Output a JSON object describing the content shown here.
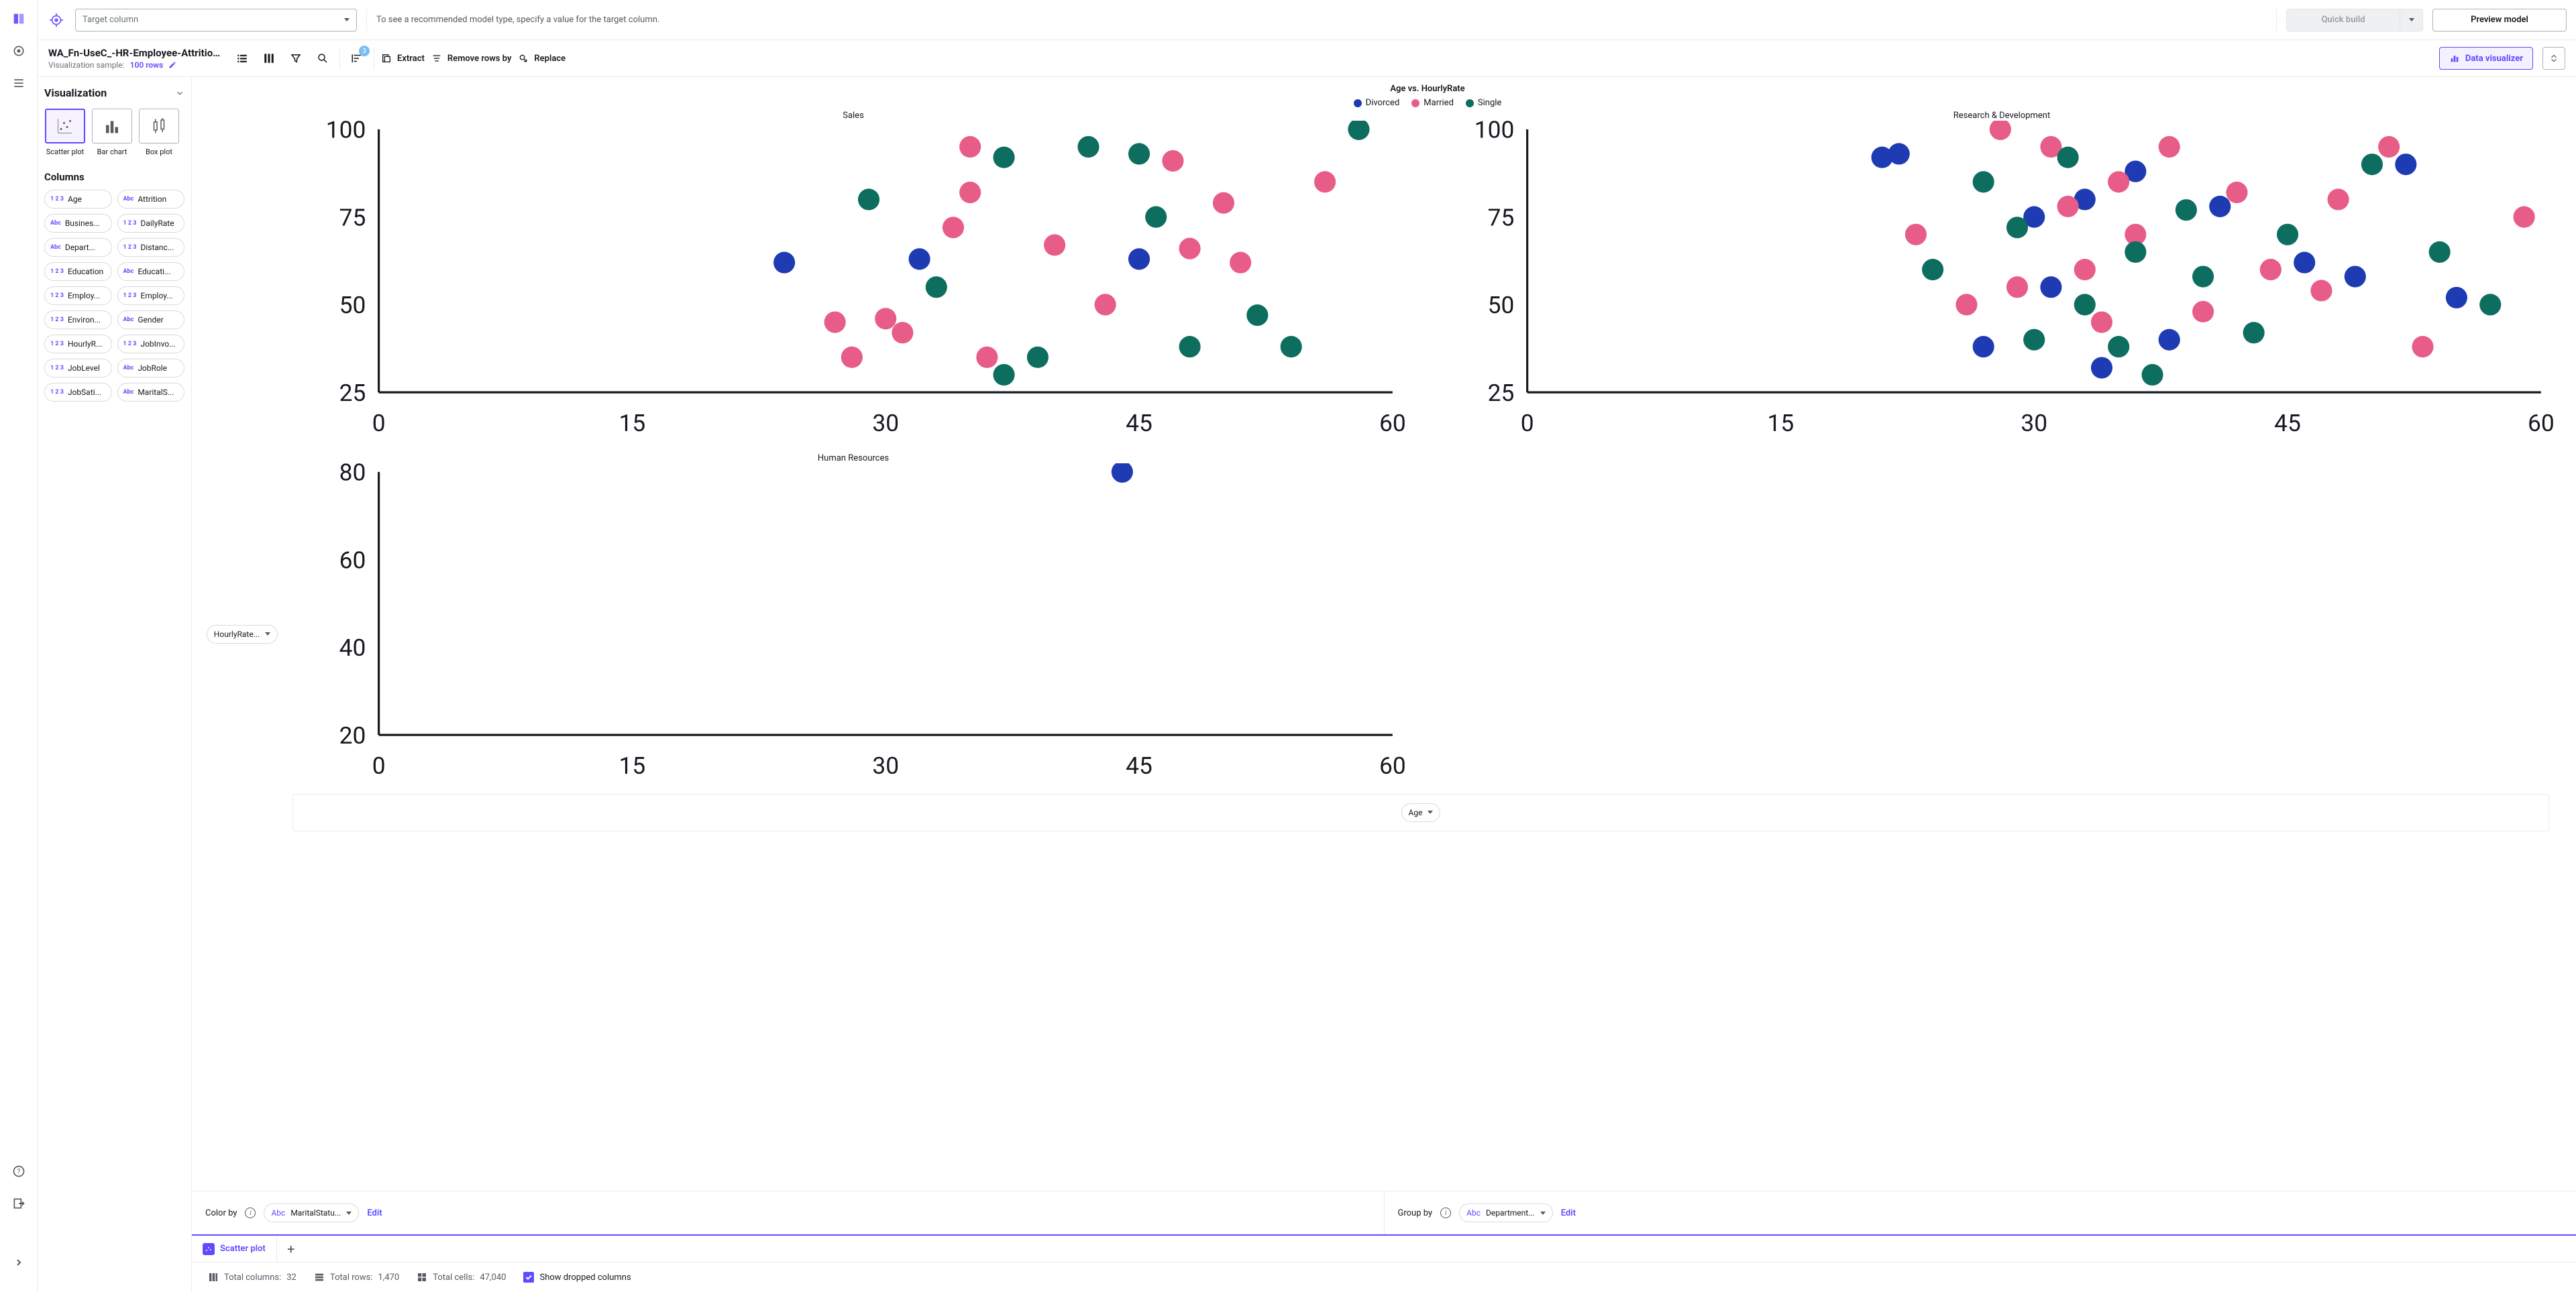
{
  "topbar": {
    "target_placeholder": "Target column",
    "hint": "To see a recommended model type, specify a value for the target column.",
    "quick_build": "Quick build",
    "preview_model": "Preview model"
  },
  "file": {
    "name": "WA_Fn-UseC_-HR-Employee-Attrition...",
    "sample_label": "Visualization sample:",
    "sample_value": "100 rows"
  },
  "toolbar": {
    "sort_badge": "3",
    "extract": "Extract",
    "remove": "Remove rows by",
    "replace": "Replace",
    "data_visualizer": "Data visualizer"
  },
  "viz": {
    "title": "Visualization",
    "tiles": [
      {
        "id": "scatter",
        "label": "Scatter plot",
        "active": true
      },
      {
        "id": "bar",
        "label": "Bar chart",
        "active": false
      },
      {
        "id": "box",
        "label": "Box plot",
        "active": false
      }
    ],
    "columns_title": "Columns",
    "columns": [
      {
        "type": "123",
        "name": "Age"
      },
      {
        "type": "Abc",
        "name": "Attrition"
      },
      {
        "type": "Abc",
        "name": "Busines..."
      },
      {
        "type": "123",
        "name": "DailyRate"
      },
      {
        "type": "Abc",
        "name": "Depart..."
      },
      {
        "type": "123",
        "name": "Distanc..."
      },
      {
        "type": "123",
        "name": "Education"
      },
      {
        "type": "Abc",
        "name": "Educati..."
      },
      {
        "type": "123",
        "name": "Employ..."
      },
      {
        "type": "123",
        "name": "Employ..."
      },
      {
        "type": "123",
        "name": "Environ..."
      },
      {
        "type": "Abc",
        "name": "Gender"
      },
      {
        "type": "123",
        "name": "HourlyR..."
      },
      {
        "type": "123",
        "name": "JobInvo..."
      },
      {
        "type": "123",
        "name": "JobLevel"
      },
      {
        "type": "Abc",
        "name": "JobRole"
      },
      {
        "type": "123",
        "name": "JobSati..."
      },
      {
        "type": "Abc",
        "name": "MaritalS..."
      }
    ]
  },
  "plot": {
    "y_pill": "HourlyRate...",
    "x_pill": "Age",
    "color_by_label": "Color by",
    "color_by_value": "MaritalStatu...",
    "group_by_label": "Group by",
    "group_by_value": "Department...",
    "edit": "Edit"
  },
  "tabs": {
    "scatter": "Scatter plot"
  },
  "status": {
    "cols_label": "Total columns:",
    "cols_value": "32",
    "rows_label": "Total rows:",
    "rows_value": "1,470",
    "cells_label": "Total cells:",
    "cells_value": "47,040",
    "show_dropped": "Show dropped columns"
  },
  "chart_data": {
    "type": "scatter",
    "title": "Age vs. HourlyRate",
    "xlabel": "Age",
    "ylabel": "HourlyRate",
    "color_by": "MaritalStatus",
    "group_by": "Department",
    "legend": [
      {
        "name": "Divorced",
        "color": "#1f3bb3"
      },
      {
        "name": "Married",
        "color": "#e85d88"
      },
      {
        "name": "Single",
        "color": "#0d6e5f"
      }
    ],
    "facets": [
      {
        "name": "Sales",
        "xlim": [
          0,
          60
        ],
        "xticks": [
          0,
          15,
          30,
          45,
          60
        ],
        "ylim": [
          25,
          100
        ],
        "yticks": [
          25,
          50,
          75,
          100
        ],
        "points": [
          {
            "x": 24,
            "y": 62,
            "c": "Divorced"
          },
          {
            "x": 32,
            "y": 63,
            "c": "Divorced"
          },
          {
            "x": 45,
            "y": 63,
            "c": "Divorced"
          },
          {
            "x": 27,
            "y": 45,
            "c": "Married"
          },
          {
            "x": 28,
            "y": 35,
            "c": "Married"
          },
          {
            "x": 30,
            "y": 46,
            "c": "Married"
          },
          {
            "x": 31,
            "y": 42,
            "c": "Married"
          },
          {
            "x": 34,
            "y": 72,
            "c": "Married"
          },
          {
            "x": 35,
            "y": 95,
            "c": "Married"
          },
          {
            "x": 35,
            "y": 82,
            "c": "Married"
          },
          {
            "x": 36,
            "y": 35,
            "c": "Married"
          },
          {
            "x": 40,
            "y": 67,
            "c": "Married"
          },
          {
            "x": 43,
            "y": 50,
            "c": "Married"
          },
          {
            "x": 47,
            "y": 91,
            "c": "Married"
          },
          {
            "x": 48,
            "y": 66,
            "c": "Married"
          },
          {
            "x": 50,
            "y": 79,
            "c": "Married"
          },
          {
            "x": 51,
            "y": 62,
            "c": "Married"
          },
          {
            "x": 56,
            "y": 85,
            "c": "Married"
          },
          {
            "x": 29,
            "y": 80,
            "c": "Single"
          },
          {
            "x": 33,
            "y": 55,
            "c": "Single"
          },
          {
            "x": 37,
            "y": 92,
            "c": "Single"
          },
          {
            "x": 37,
            "y": 30,
            "c": "Single"
          },
          {
            "x": 39,
            "y": 35,
            "c": "Single"
          },
          {
            "x": 42,
            "y": 95,
            "c": "Single"
          },
          {
            "x": 45,
            "y": 93,
            "c": "Single"
          },
          {
            "x": 46,
            "y": 75,
            "c": "Single"
          },
          {
            "x": 48,
            "y": 38,
            "c": "Single"
          },
          {
            "x": 52,
            "y": 47,
            "c": "Single"
          },
          {
            "x": 54,
            "y": 38,
            "c": "Single"
          },
          {
            "x": 58,
            "y": 100,
            "c": "Single"
          }
        ]
      },
      {
        "name": "Research & Development",
        "xlim": [
          0,
          60
        ],
        "xticks": [
          0,
          15,
          30,
          45,
          60
        ],
        "ylim": [
          25,
          100
        ],
        "yticks": [
          25,
          50,
          75,
          100
        ],
        "points": [
          {
            "x": 21,
            "y": 92,
            "c": "Divorced"
          },
          {
            "x": 22,
            "y": 93,
            "c": "Divorced"
          },
          {
            "x": 27,
            "y": 38,
            "c": "Divorced"
          },
          {
            "x": 30,
            "y": 75,
            "c": "Divorced"
          },
          {
            "x": 31,
            "y": 55,
            "c": "Divorced"
          },
          {
            "x": 33,
            "y": 80,
            "c": "Divorced"
          },
          {
            "x": 34,
            "y": 32,
            "c": "Divorced"
          },
          {
            "x": 36,
            "y": 88,
            "c": "Divorced"
          },
          {
            "x": 38,
            "y": 40,
            "c": "Divorced"
          },
          {
            "x": 41,
            "y": 78,
            "c": "Divorced"
          },
          {
            "x": 46,
            "y": 62,
            "c": "Divorced"
          },
          {
            "x": 49,
            "y": 58,
            "c": "Divorced"
          },
          {
            "x": 52,
            "y": 90,
            "c": "Divorced"
          },
          {
            "x": 55,
            "y": 52,
            "c": "Divorced"
          },
          {
            "x": 23,
            "y": 70,
            "c": "Married"
          },
          {
            "x": 26,
            "y": 50,
            "c": "Married"
          },
          {
            "x": 28,
            "y": 100,
            "c": "Married"
          },
          {
            "x": 29,
            "y": 55,
            "c": "Married"
          },
          {
            "x": 31,
            "y": 95,
            "c": "Married"
          },
          {
            "x": 32,
            "y": 78,
            "c": "Married"
          },
          {
            "x": 33,
            "y": 60,
            "c": "Married"
          },
          {
            "x": 34,
            "y": 45,
            "c": "Married"
          },
          {
            "x": 35,
            "y": 85,
            "c": "Married"
          },
          {
            "x": 36,
            "y": 70,
            "c": "Married"
          },
          {
            "x": 38,
            "y": 95,
            "c": "Married"
          },
          {
            "x": 40,
            "y": 48,
            "c": "Married"
          },
          {
            "x": 42,
            "y": 82,
            "c": "Married"
          },
          {
            "x": 44,
            "y": 60,
            "c": "Married"
          },
          {
            "x": 47,
            "y": 54,
            "c": "Married"
          },
          {
            "x": 48,
            "y": 80,
            "c": "Married"
          },
          {
            "x": 51,
            "y": 95,
            "c": "Married"
          },
          {
            "x": 53,
            "y": 38,
            "c": "Married"
          },
          {
            "x": 59,
            "y": 75,
            "c": "Married"
          },
          {
            "x": 24,
            "y": 60,
            "c": "Single"
          },
          {
            "x": 27,
            "y": 85,
            "c": "Single"
          },
          {
            "x": 29,
            "y": 72,
            "c": "Single"
          },
          {
            "x": 30,
            "y": 40,
            "c": "Single"
          },
          {
            "x": 32,
            "y": 92,
            "c": "Single"
          },
          {
            "x": 33,
            "y": 50,
            "c": "Single"
          },
          {
            "x": 35,
            "y": 38,
            "c": "Single"
          },
          {
            "x": 36,
            "y": 65,
            "c": "Single"
          },
          {
            "x": 37,
            "y": 30,
            "c": "Single"
          },
          {
            "x": 39,
            "y": 77,
            "c": "Single"
          },
          {
            "x": 40,
            "y": 58,
            "c": "Single"
          },
          {
            "x": 43,
            "y": 42,
            "c": "Single"
          },
          {
            "x": 45,
            "y": 70,
            "c": "Single"
          },
          {
            "x": 50,
            "y": 90,
            "c": "Single"
          },
          {
            "x": 54,
            "y": 65,
            "c": "Single"
          },
          {
            "x": 57,
            "y": 50,
            "c": "Single"
          }
        ]
      },
      {
        "name": "Human Resources",
        "xlim": [
          0,
          60
        ],
        "xticks": [
          0,
          15,
          30,
          45,
          60
        ],
        "ylim": [
          20,
          80
        ],
        "yticks": [
          20,
          40,
          60,
          80
        ],
        "points": [
          {
            "x": 44,
            "y": 80,
            "c": "Divorced"
          }
        ]
      }
    ]
  }
}
